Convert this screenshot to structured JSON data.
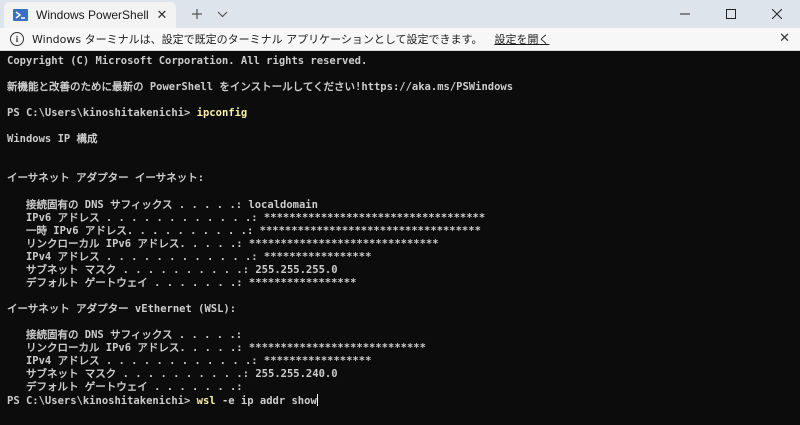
{
  "window": {
    "tab_title": "Windows PowerShell"
  },
  "infobar": {
    "message": "Windows ターミナルは、設定で既定のターミナル アプリケーションとして設定できます。",
    "link": "設定を開く"
  },
  "terminal": {
    "lines": [
      {
        "text": "Copyright (C) Microsoft Corporation. All rights reserved."
      },
      {
        "text": ""
      },
      {
        "text": "新機能と改善のために最新の PowerShell をインストールしてください!https://aka.ms/PSWindows"
      },
      {
        "text": ""
      },
      {
        "prompt": "PS C:\\Users\\kinoshitakenichi> ",
        "command": "ipconfig"
      },
      {
        "text": ""
      },
      {
        "text": "Windows IP 構成"
      },
      {
        "text": ""
      },
      {
        "text": ""
      },
      {
        "text": "イーサネット アダプター イーサネット:"
      },
      {
        "text": ""
      },
      {
        "text": "   接続固有の DNS サフィックス . . . . .: localdomain"
      },
      {
        "text": "   IPv6 アドレス . . . . . . . . . . . .: ***********************************"
      },
      {
        "text": "   一時 IPv6 アドレス. . . . . . . . . .: ***********************************"
      },
      {
        "text": "   リンクローカル IPv6 アドレス. . . . .: ******************************"
      },
      {
        "text": "   IPv4 アドレス . . . . . . . . . . . .: *****************"
      },
      {
        "text": "   サブネット マスク . . . . . . . . . .: 255.255.255.0"
      },
      {
        "text": "   デフォルト ゲートウェイ . . . . . . .: *****************"
      },
      {
        "text": ""
      },
      {
        "text": "イーサネット アダプター vEthernet (WSL):"
      },
      {
        "text": ""
      },
      {
        "text": "   接続固有の DNS サフィックス . . . . .:"
      },
      {
        "text": "   リンクローカル IPv6 アドレス. . . . .: ****************************"
      },
      {
        "text": "   IPv4 アドレス . . . . . . . . . . . .: *****************"
      },
      {
        "text": "   サブネット マスク . . . . . . . . . .: 255.255.240.0"
      },
      {
        "text": "   デフォルト ゲートウェイ . . . . . . .:"
      },
      {
        "prompt": "PS C:\\Users\\kinoshitakenichi> ",
        "command": "wsl",
        "args": " -e ip addr show",
        "cursor": true
      }
    ]
  }
}
